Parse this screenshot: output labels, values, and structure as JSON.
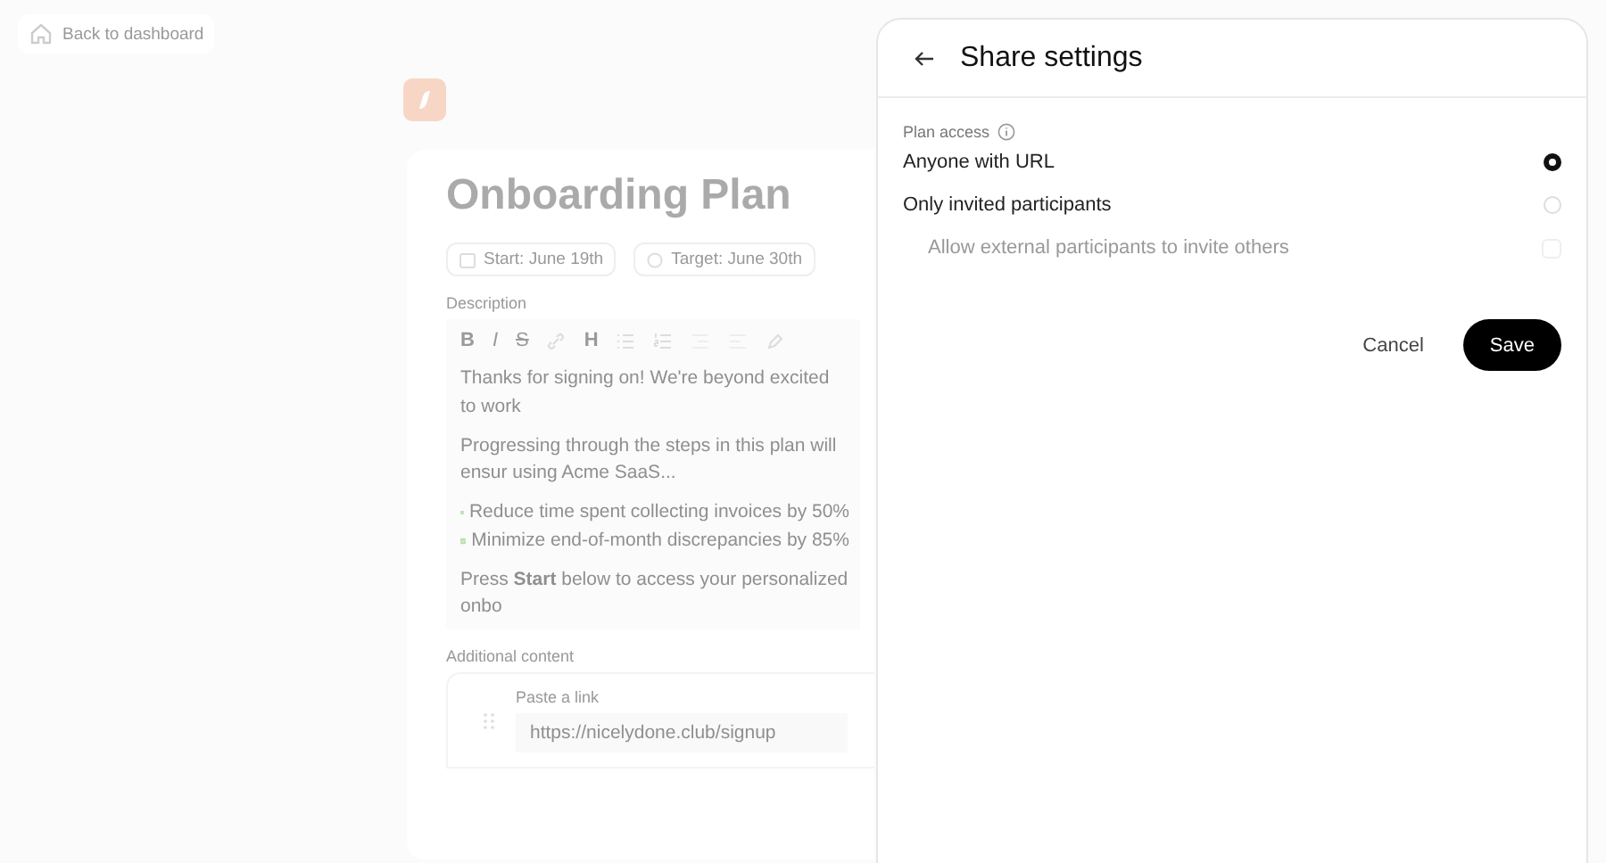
{
  "back_link": {
    "label": "Back to dashboard"
  },
  "plan": {
    "title": "Onboarding Plan",
    "dates": [
      {
        "kind": "start",
        "label": "Start: June 19th"
      },
      {
        "kind": "target",
        "label": "Target: June 30th"
      }
    ],
    "description_label": "Description",
    "toolbar": [
      {
        "kind": "bold",
        "label": "B"
      },
      {
        "kind": "italic",
        "label": "I"
      },
      {
        "kind": "strike",
        "label": "S"
      },
      {
        "kind": "link"
      },
      {
        "kind": "heading",
        "label": "H"
      },
      {
        "kind": "bullets"
      },
      {
        "kind": "numbers"
      },
      {
        "kind": "indent"
      },
      {
        "kind": "outdent"
      },
      {
        "kind": "highlight"
      }
    ],
    "description": [
      {
        "kind": "text",
        "text": "Thanks for signing on! We're beyond excited to work"
      },
      {
        "kind": "text",
        "text": "Progressing through the steps in this plan will ensur using Acme SaaS..."
      },
      {
        "kind": "checklist",
        "items": [
          "Reduce time spent collecting invoices by 50%",
          "Minimize end-of-month discrepancies by 85%"
        ]
      },
      {
        "kind": "text",
        "text": "Press **Start** below to access your personalized onbo"
      }
    ],
    "additional_label": "Additional content",
    "link_label": "Paste a link",
    "link_value": "https://nicelydone.club/signup"
  },
  "share_panel": {
    "title": "Share settings",
    "section_label": "Plan access",
    "options": [
      {
        "kind": "radio",
        "label": "Anyone with URL",
        "selected": true
      },
      {
        "kind": "radio",
        "label": "Only invited participants",
        "selected": false
      },
      {
        "kind": "checkbox",
        "label": "Allow external participants to invite others",
        "checked": false,
        "disabled": true
      }
    ],
    "buttons": [
      {
        "kind": "secondary",
        "label": "Cancel"
      },
      {
        "kind": "primary",
        "label": "Save"
      }
    ]
  }
}
